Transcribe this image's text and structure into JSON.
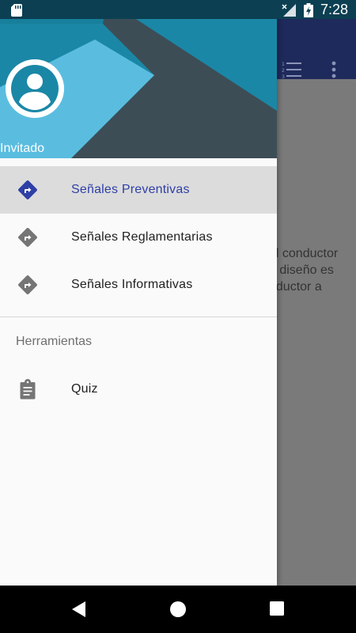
{
  "status_bar": {
    "time": "7:28"
  },
  "drawer": {
    "user_name": "Invitado",
    "items": [
      {
        "label": "Señales Preventivas",
        "icon": "sign-turn-icon",
        "active": true
      },
      {
        "label": "Señales Reglamentarias",
        "icon": "sign-turn-icon",
        "active": false
      },
      {
        "label": "Señales Informativas",
        "icon": "sign-turn-icon",
        "active": false
      }
    ],
    "section_title": "Herramientas",
    "tools": [
      {
        "label": "Quiz",
        "icon": "clipboard-icon"
      }
    ]
  },
  "background": {
    "text_lines": [
      "al conductor",
      "e diseño es",
      "nductor a"
    ]
  },
  "colors": {
    "accent": "#2e3fa6",
    "header_teal": "#1b87a6",
    "header_dark": "#3d4d56",
    "header_light": "#5abde0",
    "toolbar": "#1f2a5c"
  }
}
